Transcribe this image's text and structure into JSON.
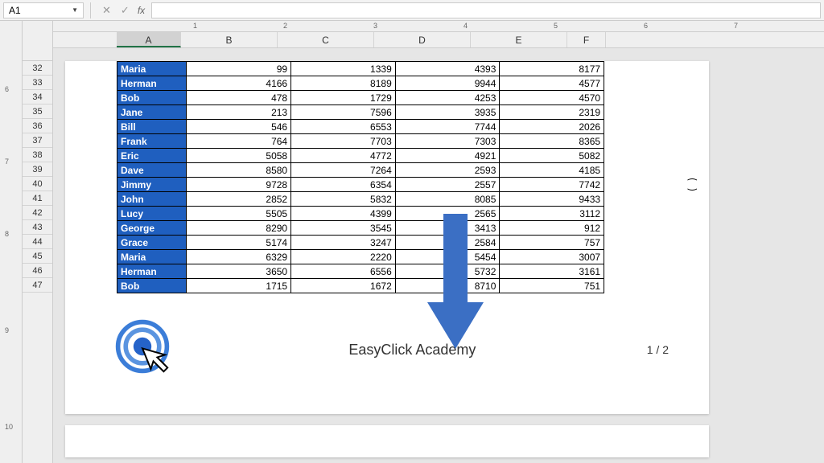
{
  "formula_bar": {
    "name_box": "A1",
    "fx": "fx"
  },
  "columns": [
    "A",
    "B",
    "C",
    "D",
    "E",
    "F"
  ],
  "row_headers": [
    32,
    33,
    34,
    35,
    36,
    37,
    38,
    39,
    40,
    41,
    42,
    43,
    44,
    45,
    46,
    47
  ],
  "left_ruler": [
    6,
    7,
    8,
    9,
    10
  ],
  "top_ruler": [
    1,
    2,
    3,
    4,
    5,
    6,
    7
  ],
  "rows": [
    {
      "name": "Maria",
      "b": 99,
      "c": 1339,
      "d": 4393,
      "e": 8177
    },
    {
      "name": "Herman",
      "b": 4166,
      "c": 8189,
      "d": 9944,
      "e": 4577
    },
    {
      "name": "Bob",
      "b": 478,
      "c": 1729,
      "d": 4253,
      "e": 4570
    },
    {
      "name": "Jane",
      "b": 213,
      "c": 7596,
      "d": 3935,
      "e": 2319
    },
    {
      "name": "Bill",
      "b": 546,
      "c": 6553,
      "d": 7744,
      "e": 2026
    },
    {
      "name": "Frank",
      "b": 764,
      "c": 7703,
      "d": 7303,
      "e": 8365
    },
    {
      "name": "Eric",
      "b": 5058,
      "c": 4772,
      "d": 4921,
      "e": 5082
    },
    {
      "name": "Dave",
      "b": 8580,
      "c": 7264,
      "d": 2593,
      "e": 4185
    },
    {
      "name": "Jimmy",
      "b": 9728,
      "c": 6354,
      "d": 2557,
      "e": 7742
    },
    {
      "name": "John",
      "b": 2852,
      "c": 5832,
      "d": 8085,
      "e": 9433
    },
    {
      "name": "Lucy",
      "b": 5505,
      "c": 4399,
      "d": 2565,
      "e": 3112
    },
    {
      "name": "George",
      "b": 8290,
      "c": 3545,
      "d": 3413,
      "e": 912
    },
    {
      "name": "Grace",
      "b": 5174,
      "c": 3247,
      "d": 2584,
      "e": 757
    },
    {
      "name": "Maria",
      "b": 6329,
      "c": 2220,
      "d": 5454,
      "e": 3007
    },
    {
      "name": "Herman",
      "b": 3650,
      "c": 6556,
      "d": 5732,
      "e": 3161
    },
    {
      "name": "Bob",
      "b": 1715,
      "c": 1672,
      "d": 8710,
      "e": 751
    }
  ],
  "footer": {
    "center": "EasyClick Academy",
    "page": "1 / 2"
  },
  "col_widths": {
    "A": 80,
    "B": 120,
    "C": 120,
    "D": 120,
    "E": 120,
    "F": 48
  }
}
